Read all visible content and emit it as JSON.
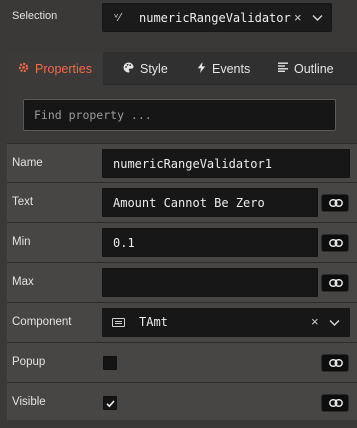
{
  "selection": {
    "label": "Selection",
    "icon": "validator-icon",
    "icon_glyph": "ᵛ⁄",
    "value": "numericRangeValidator",
    "clear_glyph": "×"
  },
  "tabs": [
    {
      "label": "Properties",
      "icon": "gear-icon",
      "active": true
    },
    {
      "label": "Style",
      "icon": "palette-icon",
      "active": false
    },
    {
      "label": "Events",
      "icon": "lightning-icon",
      "active": false
    },
    {
      "label": "Outline",
      "icon": "list-icon",
      "active": false
    }
  ],
  "find": {
    "placeholder": "Find property ..."
  },
  "properties": [
    {
      "label": "Name",
      "value": "numericRangeValidator1"
    },
    {
      "label": "Text",
      "value": "Amount Cannot Be Zero"
    },
    {
      "label": "Min",
      "value": "0.1"
    },
    {
      "label": "Max",
      "value": ""
    },
    {
      "label": "Component",
      "value": "TAmt"
    },
    {
      "label": "Popup",
      "checked": false
    },
    {
      "label": "Visible",
      "checked": true
    }
  ],
  "colors": {
    "accent": "#ef6b4b",
    "panel": "#474645",
    "input": "#171717"
  }
}
